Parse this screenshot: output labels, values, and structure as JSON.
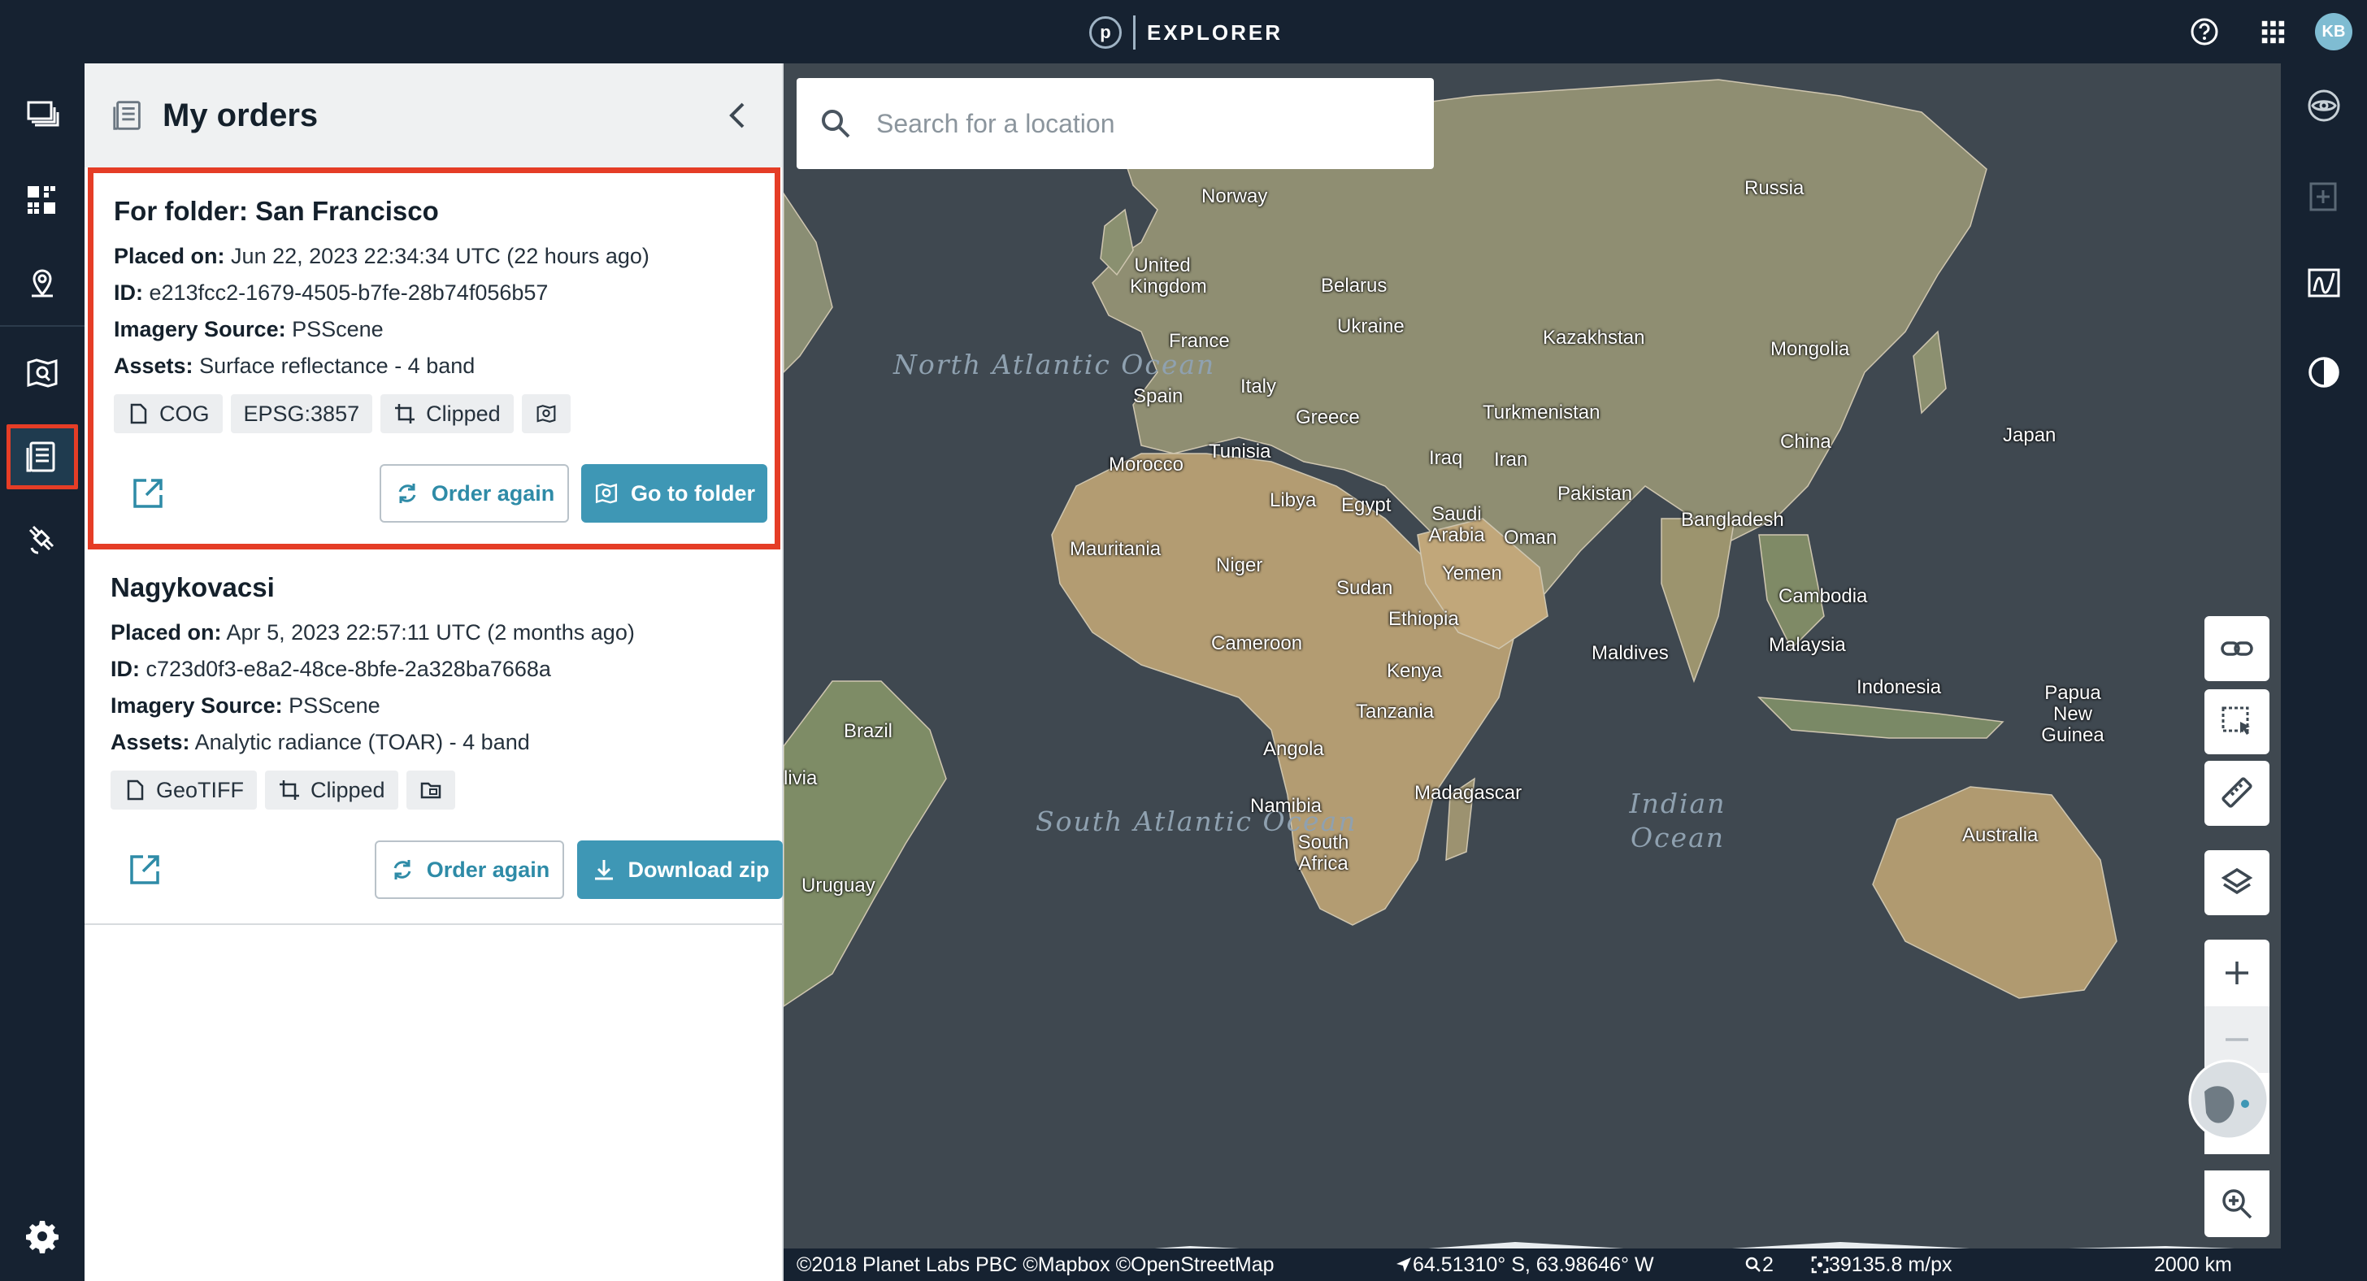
{
  "app": {
    "logo_letter": "p",
    "name": "EXPLORER",
    "user_initials": "KB"
  },
  "panel": {
    "title": "My orders"
  },
  "orders": [
    {
      "title": "For folder: San Francisco",
      "placed_label": "Placed on:",
      "placed_value": "Jun 22, 2023 22:34:34 UTC (22 hours ago)",
      "id_label": "ID:",
      "id_value": "e213fcc2-1679-4505-b7fe-28b74f056b57",
      "source_label": "Imagery Source:",
      "source_value": "PSScene",
      "assets_label": "Assets:",
      "assets_value": "Surface reflectance - 4 band",
      "chips": [
        "COG",
        "EPSG:3857",
        "Clipped"
      ],
      "order_again": "Order again",
      "secondary": "Go to folder"
    },
    {
      "title": "Nagykovacsi",
      "placed_label": "Placed on:",
      "placed_value": "Apr 5, 2023 22:57:11 UTC (2 months ago)",
      "id_label": "ID:",
      "id_value": "c723d0f3-e8a2-48ce-8bfe-2a328ba7668a",
      "source_label": "Imagery Source:",
      "source_value": "PSScene",
      "assets_label": "Assets:",
      "assets_value": "Analytic radiance (TOAR) - 4 band",
      "chips": [
        "GeoTIFF",
        "Clipped"
      ],
      "order_again": "Order again",
      "secondary": "Download zip"
    }
  ],
  "search": {
    "placeholder": "Search for a location"
  },
  "map": {
    "oceans": [
      "North Atlantic Ocean",
      "South Atlantic Ocean",
      "Indian Ocean"
    ],
    "labels": [
      "Norway",
      "Russia",
      "United Kingdom",
      "Belarus",
      "Ukraine",
      "France",
      "Kazakhstan",
      "Mongolia",
      "Italy",
      "Spain",
      "Turkmenistan",
      "Greece",
      "China",
      "Japan",
      "Tunisia",
      "Iraq",
      "Iran",
      "Morocco",
      "Pakistan",
      "Libya",
      "Egypt",
      "Saudi Arabia",
      "Oman",
      "Bangladesh",
      "Mauritania",
      "Niger",
      "Yemen",
      "Sudan",
      "Cambodia",
      "Ethiopia",
      "Cameroon",
      "Maldives",
      "Malaysia",
      "Kenya",
      "Indonesia",
      "Papua New Guinea",
      "Tanzania",
      "Brazil",
      "Angola",
      "livia",
      "Madagascar",
      "Namibia",
      "Australia",
      "South Africa",
      "Uruguay"
    ]
  },
  "status": {
    "attribution": "©2018 Planet Labs PBC ©Mapbox ©OpenStreetMap",
    "coords": "64.51310° S, 63.98646° W",
    "zoom": "2",
    "resolution": "39135.8 m/px",
    "scale": "2000 km"
  },
  "colors": {
    "accent": "#3e97b5",
    "highlight": "#e53d26",
    "nav": "#162231"
  }
}
